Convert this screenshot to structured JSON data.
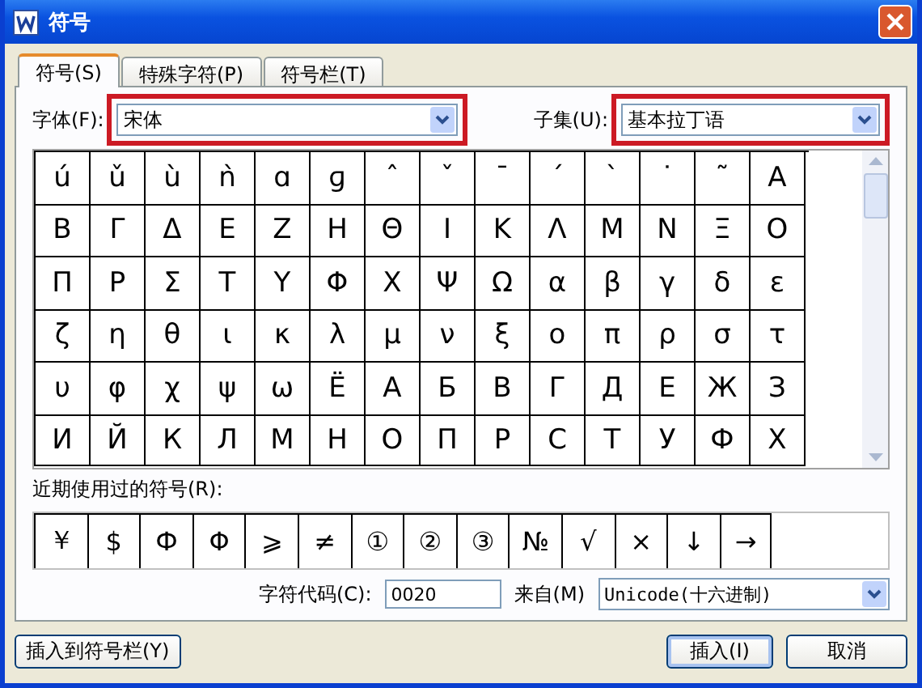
{
  "window": {
    "title": "符号"
  },
  "tabs": [
    {
      "label": "符号(S)",
      "selected": true
    },
    {
      "label": "特殊字符(P)",
      "selected": false
    },
    {
      "label": "符号栏(T)",
      "selected": false
    }
  ],
  "font": {
    "label": "字体(F):",
    "value": "宋体",
    "highlighted": true
  },
  "subset": {
    "label": "子集(U):",
    "value": "基本拉丁语",
    "highlighted": true
  },
  "symbols": [
    [
      "ú",
      "ǔ",
      "ù",
      "ǹ",
      "ɑ",
      "ɡ",
      "ˆ",
      "ˇ",
      "ˉ",
      "ˊ",
      "ˋ",
      "˙",
      "˜",
      "Α"
    ],
    [
      "Β",
      "Γ",
      "Δ",
      "Ε",
      "Ζ",
      "Η",
      "Θ",
      "Ι",
      "Κ",
      "Λ",
      "Μ",
      "Ν",
      "Ξ",
      "Ο"
    ],
    [
      "Π",
      "Ρ",
      "Σ",
      "Τ",
      "Υ",
      "Φ",
      "Χ",
      "Ψ",
      "Ω",
      "α",
      "β",
      "γ",
      "δ",
      "ε"
    ],
    [
      "ζ",
      "η",
      "θ",
      "ι",
      "κ",
      "λ",
      "μ",
      "ν",
      "ξ",
      "ο",
      "π",
      "ρ",
      "σ",
      "τ"
    ],
    [
      "υ",
      "φ",
      "χ",
      "ψ",
      "ω",
      "Ё",
      "А",
      "Б",
      "В",
      "Г",
      "Д",
      "Е",
      "Ж",
      "З"
    ],
    [
      "И",
      "Й",
      "К",
      "Л",
      "М",
      "Н",
      "О",
      "П",
      "Р",
      "С",
      "Т",
      "У",
      "Ф",
      "Х"
    ]
  ],
  "recent": {
    "label": "近期使用过的符号(R):",
    "symbols": [
      "￥",
      "$",
      "Ф",
      "Φ",
      "⩾",
      "≠",
      "①",
      "②",
      "③",
      "№",
      "√",
      "×",
      "↓",
      "→"
    ]
  },
  "char_code": {
    "label": "字符代码(C):",
    "value": "0020"
  },
  "source": {
    "label": "来自(M)",
    "value": "Unicode(十六进制)"
  },
  "buttons": {
    "insert_to_bar": "插入到符号栏(Y)",
    "insert": "插入(I)",
    "cancel": "取消"
  }
}
